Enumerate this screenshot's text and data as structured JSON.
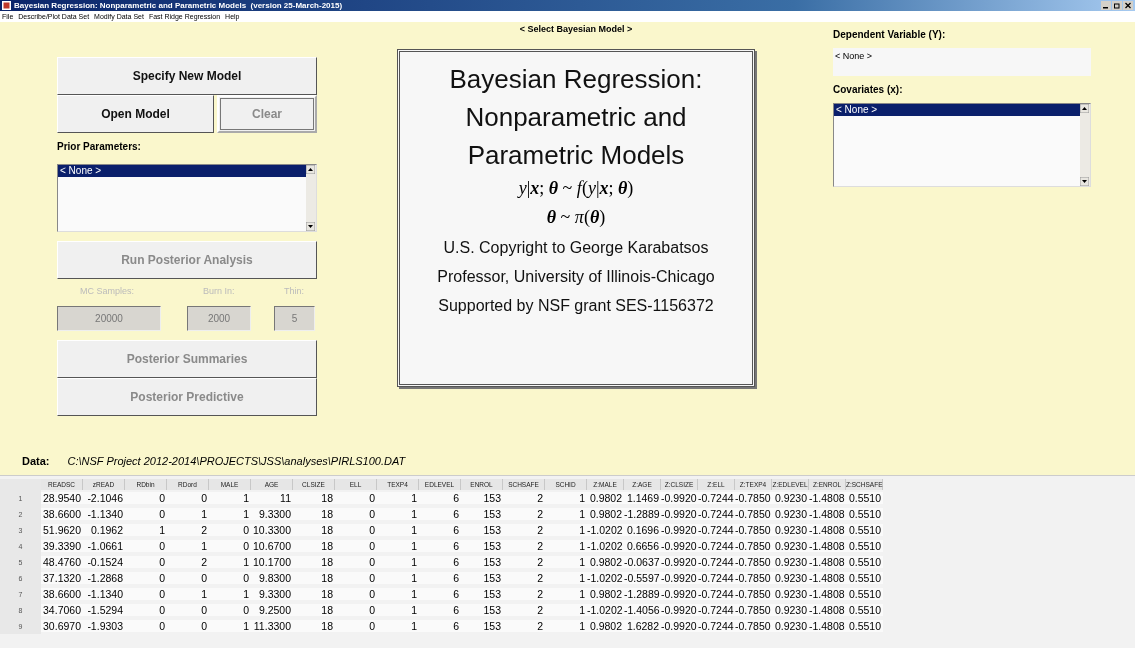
{
  "window": {
    "title": "Bayesian Regression: Nonparametric and Parametric Models  (version 25-March-2015)"
  },
  "menu": [
    "File",
    "Describe/Plot Data Set",
    "Modify Data Set",
    "Fast Ridge Regression",
    "Help"
  ],
  "left": {
    "buttons": [
      {
        "label": "Specify New Model",
        "disabled": false
      },
      {
        "label": "Open Model",
        "disabled": false
      },
      {
        "label": "Clear",
        "disabled": true
      }
    ],
    "prior_label": "Prior Parameters:",
    "prior_items": [
      {
        "text": "< None >",
        "selected": true
      }
    ],
    "run_button": {
      "label": "Run Posterior Analysis",
      "disabled": true
    },
    "fields": [
      {
        "label": "MC Samples:",
        "value": "20000",
        "disabled": true
      },
      {
        "label": "Burn In:",
        "value": "2000",
        "disabled": true
      },
      {
        "label": "Thin:",
        "value": "5",
        "disabled": true
      }
    ],
    "bottom_buttons": [
      {
        "label": "Posterior Summaries",
        "disabled": true
      },
      {
        "label": "Posterior Predictive",
        "disabled": true
      }
    ]
  },
  "center": {
    "heading": "< Select Bayesian Model >",
    "title_lines": [
      "Bayesian Regression:",
      "Nonparametric and",
      "Parametric Models"
    ],
    "formulas": [
      "*y*|**x**; **θ** ~ *f*(*y*|**x**; **θ**)",
      "**θ** ~ *π*(**θ**)"
    ],
    "credits": [
      "U.S. Copyright to George Karabatsos",
      "Professor, University of Illinois-Chicago",
      "Supported by NSF grant SES-1156372"
    ]
  },
  "right": {
    "dependent_label": "Dependent Variable (Y):",
    "dependent_value": "< None >",
    "covariates_label": "Covariates (x):",
    "covariate_items": [
      {
        "text": "< None >",
        "selected": true
      }
    ]
  },
  "data": {
    "label": "Data:",
    "path": "C:\\NSF Project 2012-2014\\PROJECTS\\JSS\\analyses\\PIRLS100.DAT"
  },
  "table": {
    "columns": [
      "READSC",
      "zREAD",
      "RDbin",
      "RDord",
      "MALE",
      "AGE",
      "CLSIZE",
      "ELL",
      "TEXP4",
      "EDLEVEL",
      "ENROL",
      "SCHSAFE",
      "SCHID",
      "Z:MALE",
      "Z:AGE",
      "Z:CLSIZE",
      "Z:ELL",
      "Z:TEXP4",
      "Z:EDLEVEL",
      "Z:ENROL",
      "Z:SCHSAFE"
    ],
    "rows": [
      {
        "n": "1",
        "cells": [
          "28.9540",
          "-2.1046",
          "0",
          "0",
          "1",
          "11",
          "18",
          "0",
          "1",
          "6",
          "153",
          "2",
          "1",
          "0.9802",
          "1.1469",
          "-0.9920",
          "-0.7244",
          "-0.7850",
          "0.9230",
          "-1.4808",
          "0.5510"
        ]
      },
      {
        "n": "2",
        "cells": [
          "38.6600",
          "-1.1340",
          "0",
          "1",
          "1",
          "9.3300",
          "18",
          "0",
          "1",
          "6",
          "153",
          "2",
          "1",
          "0.9802",
          "-1.2889",
          "-0.9920",
          "-0.7244",
          "-0.7850",
          "0.9230",
          "-1.4808",
          "0.5510"
        ]
      },
      {
        "n": "3",
        "cells": [
          "51.9620",
          "0.1962",
          "1",
          "2",
          "0",
          "10.3300",
          "18",
          "0",
          "1",
          "6",
          "153",
          "2",
          "1",
          "-1.0202",
          "0.1696",
          "-0.9920",
          "-0.7244",
          "-0.7850",
          "0.9230",
          "-1.4808",
          "0.5510"
        ]
      },
      {
        "n": "4",
        "cells": [
          "39.3390",
          "-1.0661",
          "0",
          "1",
          "0",
          "10.6700",
          "18",
          "0",
          "1",
          "6",
          "153",
          "2",
          "1",
          "-1.0202",
          "0.6656",
          "-0.9920",
          "-0.7244",
          "-0.7850",
          "0.9230",
          "-1.4808",
          "0.5510"
        ]
      },
      {
        "n": "5",
        "cells": [
          "48.4760",
          "-0.1524",
          "0",
          "2",
          "1",
          "10.1700",
          "18",
          "0",
          "1",
          "6",
          "153",
          "2",
          "1",
          "0.9802",
          "-0.0637",
          "-0.9920",
          "-0.7244",
          "-0.7850",
          "0.9230",
          "-1.4808",
          "0.5510"
        ]
      },
      {
        "n": "6",
        "cells": [
          "37.1320",
          "-1.2868",
          "0",
          "0",
          "0",
          "9.8300",
          "18",
          "0",
          "1",
          "6",
          "153",
          "2",
          "1",
          "-1.0202",
          "-0.5597",
          "-0.9920",
          "-0.7244",
          "-0.7850",
          "0.9230",
          "-1.4808",
          "0.5510"
        ]
      },
      {
        "n": "7",
        "cells": [
          "38.6600",
          "-1.1340",
          "0",
          "1",
          "1",
          "9.3300",
          "18",
          "0",
          "1",
          "6",
          "153",
          "2",
          "1",
          "0.9802",
          "-1.2889",
          "-0.9920",
          "-0.7244",
          "-0.7850",
          "0.9230",
          "-1.4808",
          "0.5510"
        ]
      },
      {
        "n": "8",
        "cells": [
          "34.7060",
          "-1.5294",
          "0",
          "0",
          "0",
          "9.2500",
          "18",
          "0",
          "1",
          "6",
          "153",
          "2",
          "1",
          "-1.0202",
          "-1.4056",
          "-0.9920",
          "-0.7244",
          "-0.7850",
          "0.9230",
          "-1.4808",
          "0.5510"
        ]
      },
      {
        "n": "9",
        "cells": [
          "30.6970",
          "-1.9303",
          "0",
          "0",
          "1",
          "11.3300",
          "18",
          "0",
          "1",
          "6",
          "153",
          "2",
          "1",
          "0.9802",
          "1.6282",
          "-0.9920",
          "-0.7244",
          "-0.7850",
          "0.9230",
          "-1.4808",
          "0.5510"
        ]
      }
    ]
  }
}
